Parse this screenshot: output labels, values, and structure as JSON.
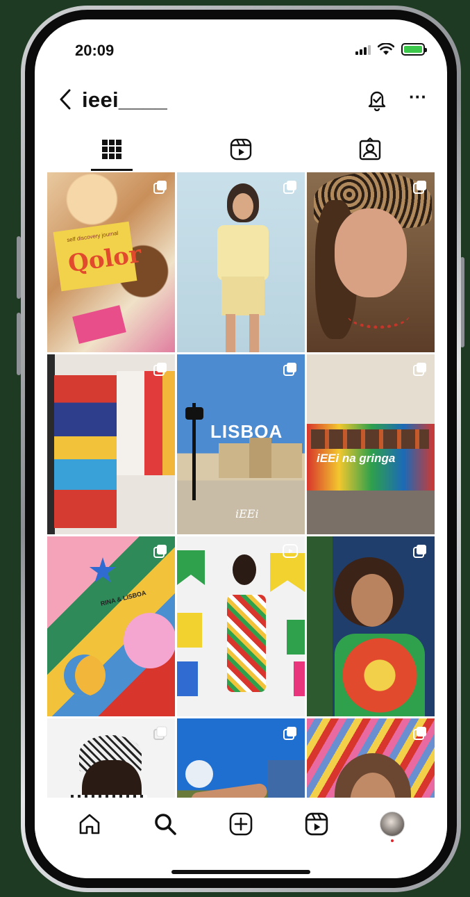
{
  "status_bar": {
    "time": "20:09"
  },
  "header": {
    "username": "ieei____"
  },
  "tabs": [
    {
      "name": "posts-grid",
      "active": true
    },
    {
      "name": "reels",
      "active": false
    },
    {
      "name": "tagged",
      "active": false
    }
  ],
  "posts": {
    "tile1_text": "Qolor",
    "tile1_subtext": "self discovery journal",
    "tile5_text": "LISBOA",
    "tile5_logo": "iEEi",
    "tile6_text": "iEEi na gringa",
    "tile7_text": "RINA & LISBOA"
  },
  "colors": {
    "background": "#1e3a22",
    "battery": "#3cc84a",
    "notification_dot": "#e4252c"
  }
}
